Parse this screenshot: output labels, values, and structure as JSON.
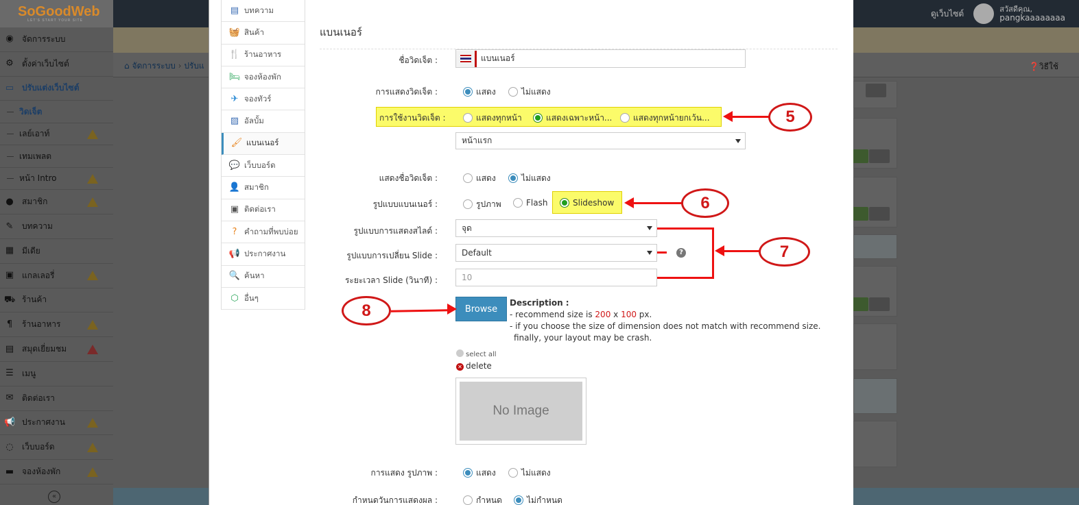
{
  "app": {
    "logo": "SoGoodWeb",
    "logo_tagline": "LET'S START YOUR SITE",
    "visit_site": "ดูเว็บไซต์",
    "greeting": "สวัสดีคุณ,",
    "username": "pangkaaaaaaaa",
    "howto": "วิธีใช้"
  },
  "sidebar": {
    "items": [
      {
        "label": "จัดการระบบ",
        "icon": "dashboard-icon",
        "glyph": "◉"
      },
      {
        "label": "ตั้งค่าเว็บไซต์",
        "icon": "gear-icon",
        "glyph": "⚙"
      },
      {
        "label": "ปรับแต่งเว็บไซต์",
        "icon": "monitor-icon",
        "glyph": "▭"
      },
      {
        "label": "วิดเจ็ต",
        "sub": true
      },
      {
        "label": "เลย์เอาท์",
        "sub": true,
        "warn": "yellow"
      },
      {
        "label": "เทมเพลต",
        "sub": true
      },
      {
        "label": "หน้า Intro",
        "sub": true,
        "warn": "yellow"
      },
      {
        "label": "สมาชิก",
        "icon": "user-icon",
        "glyph": "●",
        "warn": "yellow"
      },
      {
        "label": "บทความ",
        "icon": "edit-icon",
        "glyph": "✎"
      },
      {
        "label": "มีเดีย",
        "icon": "film-icon",
        "glyph": "▦"
      },
      {
        "label": "แกลเลอรี่",
        "icon": "grid-icon",
        "glyph": "▣",
        "warn": "yellow"
      },
      {
        "label": "ร้านค้า",
        "icon": "cart-icon",
        "glyph": "⛟"
      },
      {
        "label": "ร้านอาหาร",
        "icon": "fork-knife-icon",
        "glyph": "¶",
        "warn": "yellow"
      },
      {
        "label": "สมุดเยี่ยมชม",
        "icon": "book-icon",
        "glyph": "▤",
        "warn": "red"
      },
      {
        "label": "เมนู",
        "icon": "menu-list-icon",
        "glyph": "☰"
      },
      {
        "label": "ติดต่อเรา",
        "icon": "envelope-icon",
        "glyph": "✉"
      },
      {
        "label": "ประกาศงาน",
        "icon": "megaphone-icon",
        "glyph": "📢",
        "warn": "yellow"
      },
      {
        "label": "เว็บบอร์ด",
        "icon": "chat-icon",
        "glyph": "◌",
        "warn": "yellow"
      },
      {
        "label": "จองห้องพัก",
        "icon": "bed-icon",
        "glyph": "▬",
        "warn": "yellow"
      }
    ]
  },
  "breadcrumb": {
    "home": "จัดการระบบ",
    "current": "ปรับแ"
  },
  "modal_menu": [
    {
      "label": "บทความ",
      "icon": "article-icon",
      "glyph": "▤",
      "color": "#3c6eb4"
    },
    {
      "label": "สินค้า",
      "icon": "basket-icon",
      "glyph": "🧺",
      "color": "#d63384"
    },
    {
      "label": "ร้านอาหาร",
      "icon": "restaurant-icon",
      "glyph": "🍴",
      "color": "#e8831c"
    },
    {
      "label": "จองห้องพัก",
      "icon": "bed-icon",
      "glyph": "🛏",
      "color": "#2aa55a"
    },
    {
      "label": "จองทัวร์",
      "icon": "airplane-icon",
      "glyph": "✈",
      "color": "#2a8ad4"
    },
    {
      "label": "อัลบั้ม",
      "icon": "album-icon",
      "glyph": "▨",
      "color": "#3c6eb4"
    },
    {
      "label": "แบนเนอร์",
      "icon": "brush-icon",
      "glyph": "🖌",
      "color": "#e8831c",
      "active": true
    },
    {
      "label": "เว็บบอร์ด",
      "icon": "speech-bubble-icon",
      "glyph": "💬",
      "color": "#2ab0c8"
    },
    {
      "label": "สมาชิก",
      "icon": "member-icon",
      "glyph": "👤",
      "color": "#8a2a2a"
    },
    {
      "label": "ติดต่อเรา",
      "icon": "contact-card-icon",
      "glyph": "▣",
      "color": "#555"
    },
    {
      "label": "คำถามที่พบบ่อย",
      "icon": "question-icon",
      "glyph": "?",
      "color": "#e8831c"
    },
    {
      "label": "ประกาศงาน",
      "icon": "announce-icon",
      "glyph": "📢",
      "color": "#3c6eb4"
    },
    {
      "label": "ค้นหา",
      "icon": "search-icon",
      "glyph": "🔍",
      "color": "#c0306e"
    },
    {
      "label": "อื่นๆ",
      "icon": "cube-icon",
      "glyph": "⬡",
      "color": "#2aa55a"
    }
  ],
  "form": {
    "section_title": "แบนเนอร์",
    "widget_name": {
      "label": "ชื่อวิดเจ็ต :",
      "value": "แบนเนอร์"
    },
    "widget_display": {
      "label": "การแสดงวิดเจ็ต :",
      "options": [
        "แสดง",
        "ไม่แสดง"
      ],
      "selected": "แสดง"
    },
    "widget_usage": {
      "label": "การใช้งานวิดเจ็ต :",
      "options": [
        "แสดงทุกหน้า",
        "แสดงเฉพาะหน้า...",
        "แสดงทุกหน้ายกเว้น..."
      ],
      "selected": "แสดงเฉพาะหน้า..."
    },
    "page_select": {
      "value": "หน้าแรก"
    },
    "show_widget_name": {
      "label": "แสดงชื่อวิดเจ็ต :",
      "options": [
        "แสดง",
        "ไม่แสดง"
      ],
      "selected": "ไม่แสดง"
    },
    "banner_type": {
      "label": "รูปแบบแบนเนอร์ :",
      "options": [
        "รูปภาพ",
        "Flash",
        "Slideshow"
      ],
      "selected": "Slideshow"
    },
    "slide_display": {
      "label": "รูปแบบการแสดงสไลด์ :",
      "value": "จุด"
    },
    "slide_transition": {
      "label": "รูปแบบการเปลี่ยน Slide :",
      "value": "Default"
    },
    "slide_duration": {
      "label": "ระยะเวลา Slide (วินาที) :",
      "placeholder": "10"
    },
    "browse_label": "Browse",
    "description": {
      "title": "Description :",
      "line1_prefix": "- recommend size is ",
      "width": "200",
      "times": " x ",
      "height": "100",
      "line1_suffix": " px.",
      "line2": "- if you choose the size of dimension does not match with recommend size.",
      "line3": "finally, your layout may be crash."
    },
    "select_all": "select all",
    "delete": "delete",
    "no_image": "No Image",
    "show_image": {
      "label": "การแสดง รูปภาพ :",
      "options": [
        "แสดง",
        "ไม่แสดง"
      ],
      "selected": "แสดง"
    },
    "display_date": {
      "label": "กำหนดวันการแสดงผล :",
      "options": [
        "กำหนด",
        "ไม่กำหนด"
      ],
      "selected": "ไม่กำหนด"
    }
  },
  "annotations": {
    "callouts": [
      "5",
      "6",
      "7",
      "8"
    ],
    "arrow_color": "#e11111",
    "highlight_color": "#fbfb6a"
  }
}
